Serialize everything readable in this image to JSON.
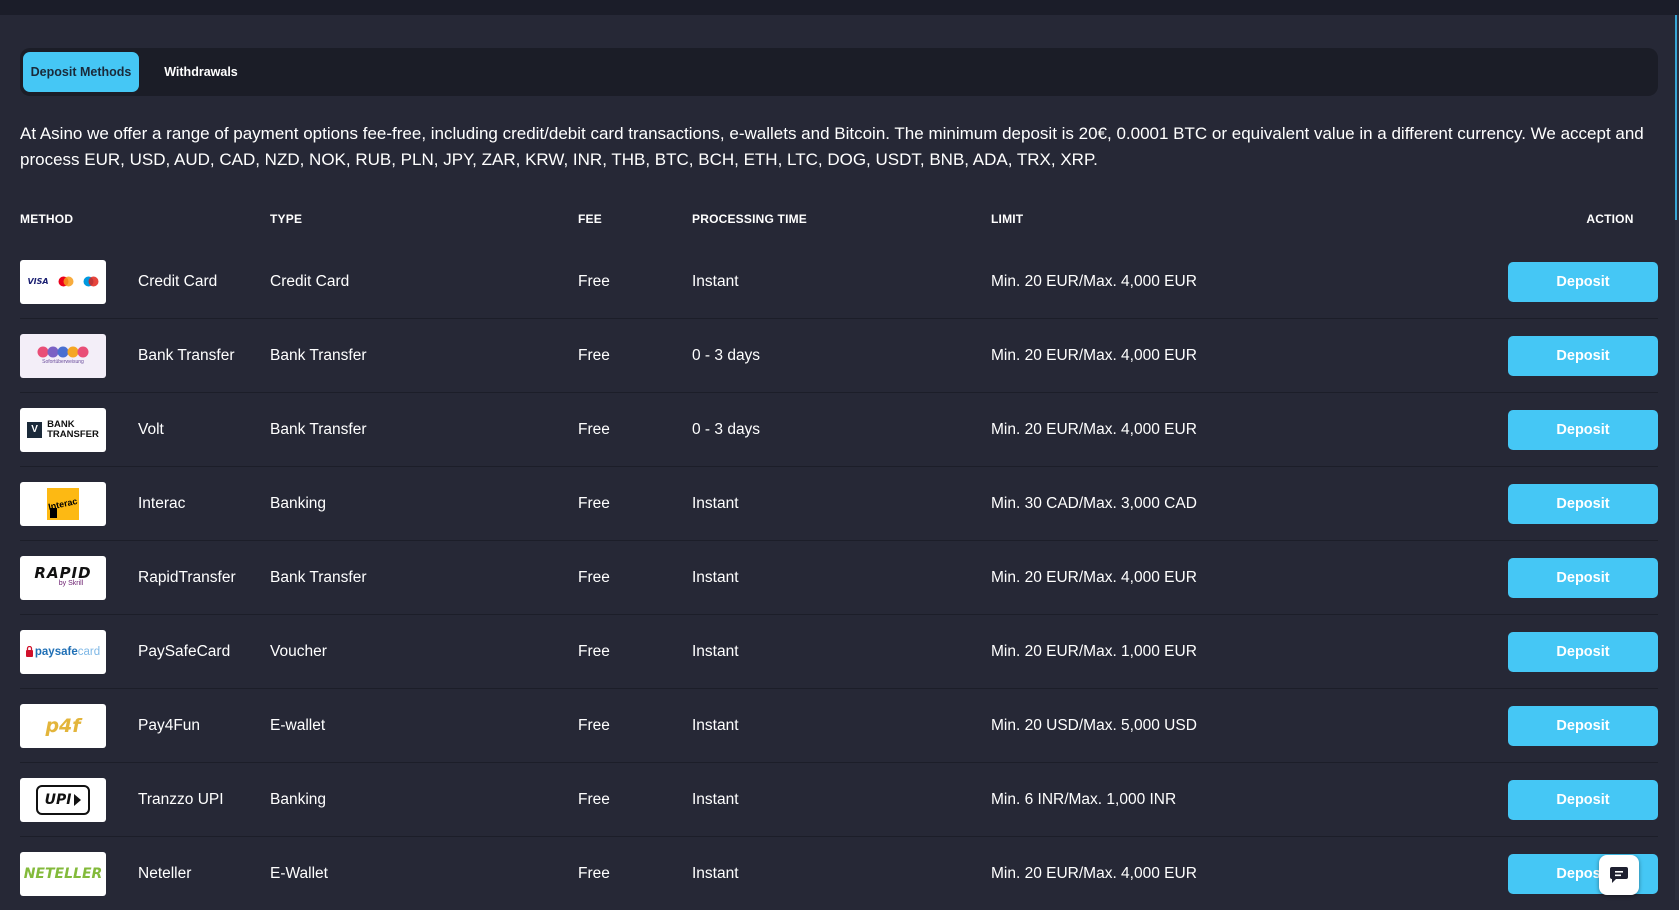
{
  "tabs": [
    {
      "label": "Deposit Methods",
      "active": true
    },
    {
      "label": "Withdrawals",
      "active": false
    }
  ],
  "intro": "At Asino we offer a range of payment options fee-free, including credit/debit card transactions, e-wallets and Bitcoin. The minimum deposit is 20€, 0.0001 BTC or equivalent value in a different currency. We accept and process EUR, USD, AUD, CAD, NZD, NOK, RUB, PLN, JPY, ZAR, KRW, INR, THB, BTC, BCH, ETH, LTC, DOG, USDT, BNB, ADA, TRX, XRP.",
  "table": {
    "headers": {
      "method": "METHOD",
      "type": "TYPE",
      "fee": "FEE",
      "processing_time": "PROCESSING TIME",
      "limit": "LIMIT",
      "action": "ACTION"
    },
    "rows": [
      {
        "logo_icon": "visa-mastercard-maestro-logo",
        "name": "Credit Card",
        "type": "Credit Card",
        "fee": "Free",
        "processing_time": "Instant",
        "limit": "Min. 20 EUR/Max. 4,000 EUR",
        "action": "Deposit"
      },
      {
        "logo_icon": "sofort-logo",
        "name": "Bank Transfer",
        "type": "Bank Transfer",
        "fee": "Free",
        "processing_time": "0 - 3 days",
        "limit": "Min. 20 EUR/Max. 4,000 EUR",
        "action": "Deposit"
      },
      {
        "logo_icon": "volt-bank-transfer-logo",
        "name": "Volt",
        "type": "Bank Transfer",
        "fee": "Free",
        "processing_time": "0 - 3 days",
        "limit": "Min. 20 EUR/Max. 4,000 EUR",
        "action": "Deposit"
      },
      {
        "logo_icon": "interac-logo",
        "name": "Interac",
        "type": "Banking",
        "fee": "Free",
        "processing_time": "Instant",
        "limit": "Min. 30 CAD/Max. 3,000 CAD",
        "action": "Deposit"
      },
      {
        "logo_icon": "rapid-transfer-logo",
        "name": "RapidTransfer",
        "type": "Bank Transfer",
        "fee": "Free",
        "processing_time": "Instant",
        "limit": "Min. 20 EUR/Max. 4,000 EUR",
        "action": "Deposit"
      },
      {
        "logo_icon": "paysafecard-logo",
        "name": "PaySafeCard",
        "type": "Voucher",
        "fee": "Free",
        "processing_time": "Instant",
        "limit": "Min. 20 EUR/Max. 1,000 EUR",
        "action": "Deposit"
      },
      {
        "logo_icon": "pay4fun-logo",
        "name": "Pay4Fun",
        "type": "E-wallet",
        "fee": "Free",
        "processing_time": "Instant",
        "limit": "Min. 20 USD/Max. 5,000 USD",
        "action": "Deposit"
      },
      {
        "logo_icon": "upi-logo",
        "name": "Tranzzo UPI",
        "type": "Banking",
        "fee": "Free",
        "processing_time": "Instant",
        "limit": "Min. 6 INR/Max. 1,000 INR",
        "action": "Deposit"
      },
      {
        "logo_icon": "neteller-logo",
        "name": "Neteller",
        "type": "E-Wallet",
        "fee": "Free",
        "processing_time": "Instant",
        "limit": "Min. 20 EUR/Max. 4,000 EUR",
        "action": "Deposit"
      }
    ]
  },
  "logos": {
    "visa": "VISA",
    "bank_transfer_line1": "BANK",
    "bank_transfer_line2": "TRANSFER",
    "volt_mark": "V",
    "interac": "Interac",
    "rapid": "RAPID",
    "rapid_sub": "by Skrill",
    "paysafe": "paysafe",
    "paysafe_card": "card",
    "pay4fun": "p4f",
    "upi": "UPI",
    "neteller": "NETELLER",
    "sofort_sub": "Sofortüberweisung"
  },
  "chat_icon": "chat-bubble-icon",
  "colors": {
    "background": "#262836",
    "accent": "#45c7f5",
    "tab_bar": "#1b1d27"
  }
}
